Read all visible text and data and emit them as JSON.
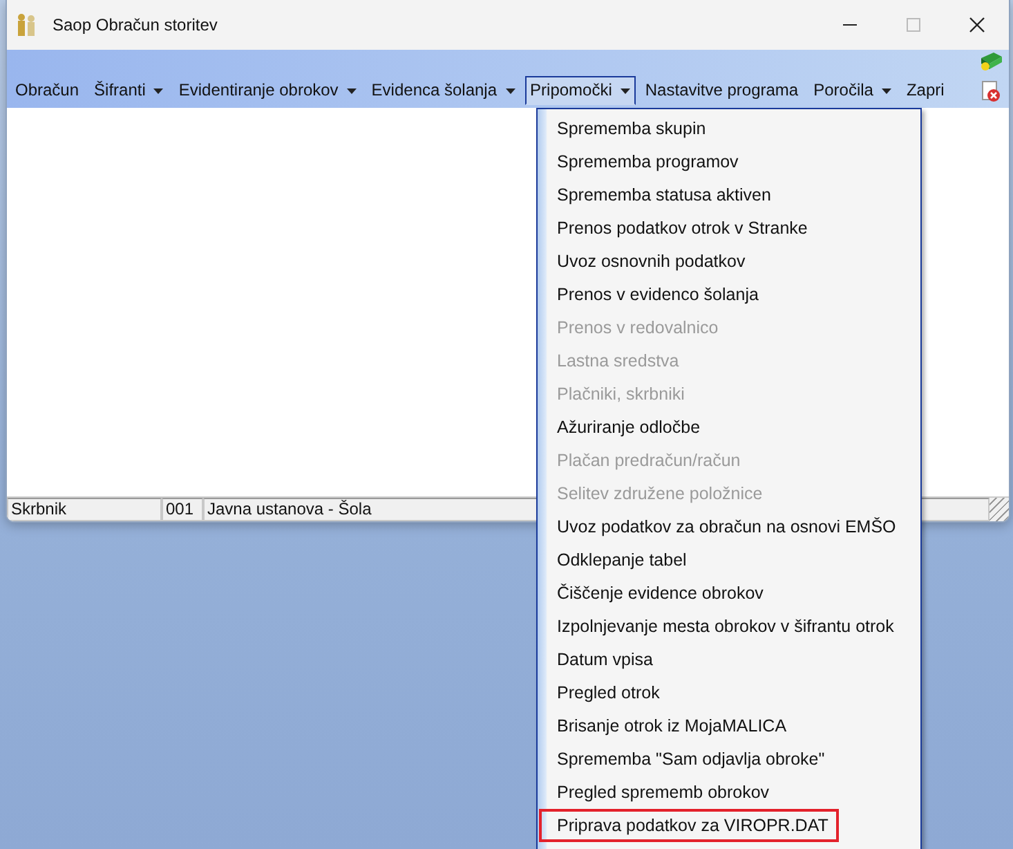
{
  "window": {
    "title": "Saop Obračun storitev"
  },
  "menu": [
    {
      "label": "Obračun",
      "dropdown": false,
      "selected": false
    },
    {
      "label": "Šifranti",
      "dropdown": true,
      "selected": false
    },
    {
      "label": "Evidentiranje obrokov",
      "dropdown": true,
      "selected": false
    },
    {
      "label": "Evidenca šolanja",
      "dropdown": true,
      "selected": false
    },
    {
      "label": "Pripomočki",
      "dropdown": true,
      "selected": true
    },
    {
      "label": "Nastavitve programa",
      "dropdown": false,
      "selected": false
    },
    {
      "label": "Poročila",
      "dropdown": true,
      "selected": false
    },
    {
      "label": "Zapri",
      "dropdown": false,
      "selected": false
    }
  ],
  "status_bar": [
    "Skrbnik",
    "001",
    "Javna ustanova - Šola"
  ],
  "dropdown": [
    {
      "label": "Sprememba skupin",
      "disabled": false,
      "highlighted": false
    },
    {
      "label": "Sprememba programov",
      "disabled": false,
      "highlighted": false
    },
    {
      "label": "Sprememba statusa aktiven",
      "disabled": false,
      "highlighted": false
    },
    {
      "label": "Prenos podatkov otrok v Stranke",
      "disabled": false,
      "highlighted": false
    },
    {
      "label": "Uvoz osnovnih podatkov",
      "disabled": false,
      "highlighted": false
    },
    {
      "label": "Prenos v evidenco šolanja",
      "disabled": false,
      "highlighted": false
    },
    {
      "label": "Prenos v redovalnico",
      "disabled": true,
      "highlighted": false
    },
    {
      "label": "Lastna sredstva",
      "disabled": true,
      "highlighted": false
    },
    {
      "label": "Plačniki, skrbniki",
      "disabled": true,
      "highlighted": false
    },
    {
      "label": "Ažuriranje odločbe",
      "disabled": false,
      "highlighted": false
    },
    {
      "label": "Plačan predračun/račun",
      "disabled": true,
      "highlighted": false
    },
    {
      "label": "Selitev združene položnice",
      "disabled": true,
      "highlighted": false
    },
    {
      "label": "Uvoz podatkov za obračun na osnovi EMŠO",
      "disabled": false,
      "highlighted": false
    },
    {
      "label": "Odklepanje  tabel",
      "disabled": false,
      "highlighted": false
    },
    {
      "label": "Čiščenje evidence obrokov",
      "disabled": false,
      "highlighted": false
    },
    {
      "label": "Izpolnjevanje mesta obrokov v šifrantu otrok",
      "disabled": false,
      "highlighted": false
    },
    {
      "label": "Datum vpisa",
      "disabled": false,
      "highlighted": false
    },
    {
      "label": "Pregled otrok",
      "disabled": false,
      "highlighted": false
    },
    {
      "label": "Brisanje otrok iz MojaMALICA",
      "disabled": false,
      "highlighted": false
    },
    {
      "label": "Sprememba \"Sam odjavlja obroke\"",
      "disabled": false,
      "highlighted": false
    },
    {
      "label": "Pregled sprememb obrokov",
      "disabled": false,
      "highlighted": false
    },
    {
      "label": "Priprava podatkov za VIROPR.DAT",
      "disabled": false,
      "highlighted": true
    }
  ]
}
